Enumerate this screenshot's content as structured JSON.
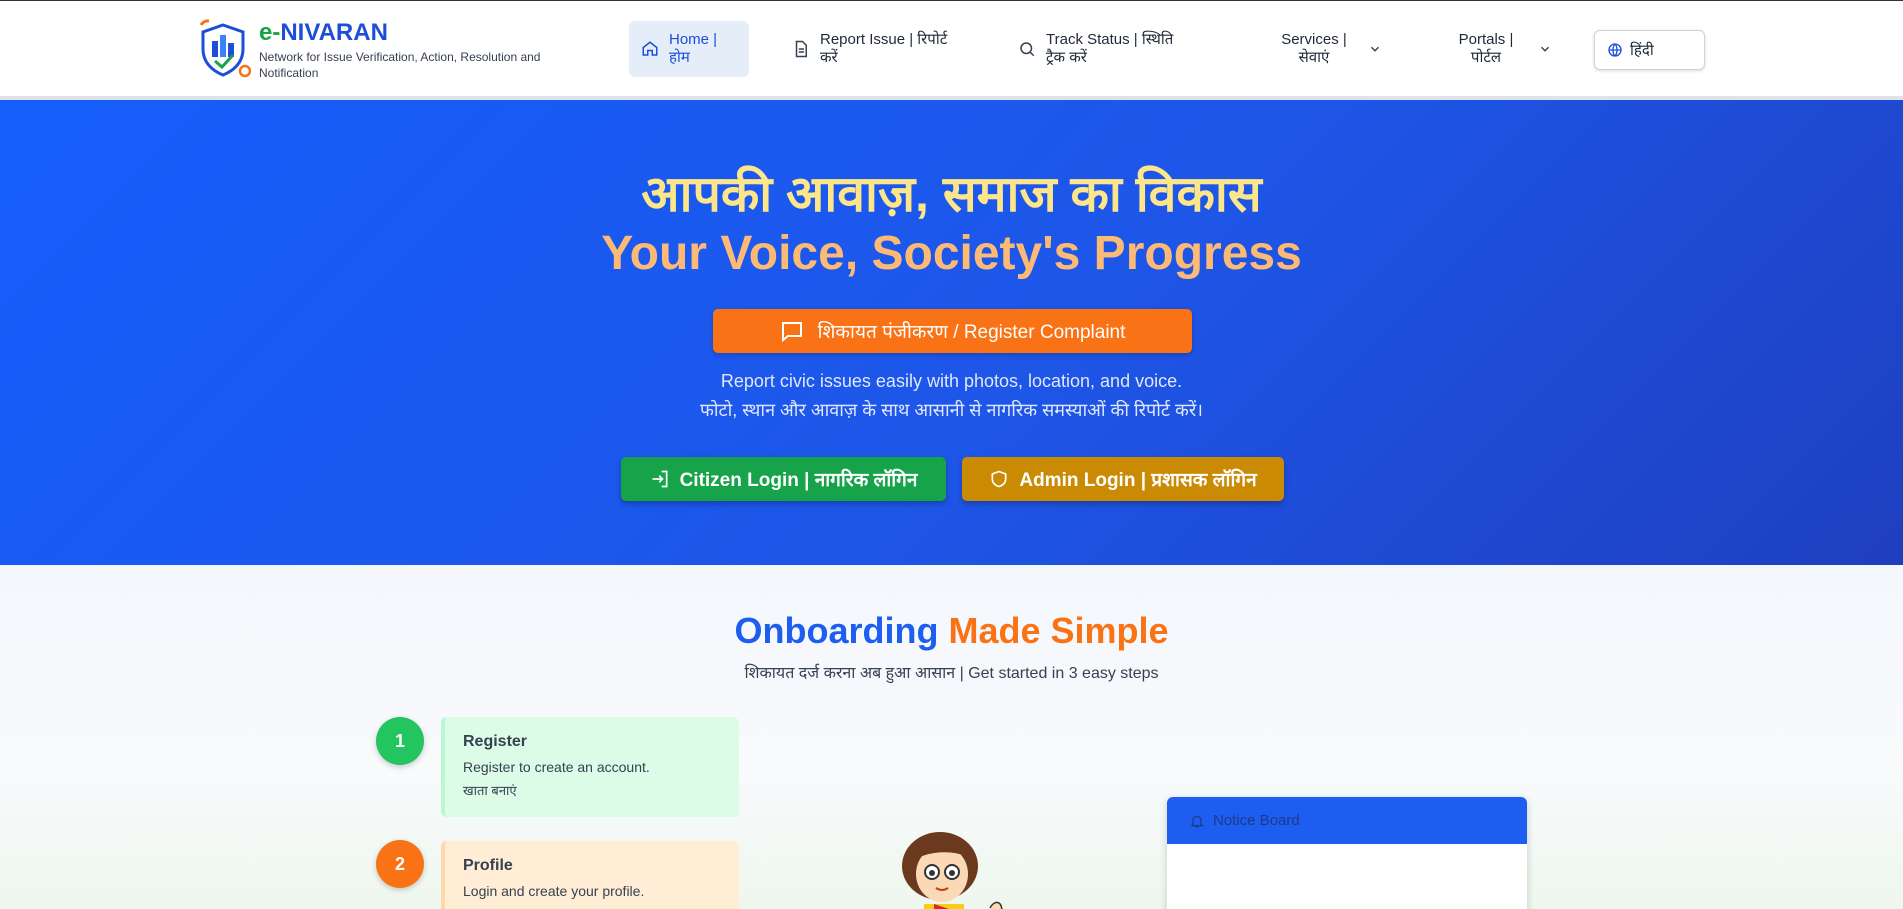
{
  "brand": {
    "name_prefix": "e-",
    "name_main": "NIVARAN",
    "tagline": "Network for Issue Verification, Action, Resolution and Notification"
  },
  "nav": {
    "home": "Home | होम",
    "report": "Report Issue | रिपोर्ट करें",
    "track": "Track Status | स्थिति ट्रैक करें",
    "services": "Services | सेवाएं",
    "portals": "Portals | पोर्टल",
    "language": "हिंदी"
  },
  "hero": {
    "title_hi": "आपकी आवाज़, समाज का विकास",
    "title_en": "Your Voice, Society's Progress",
    "register_label": "शिकायत पंजीकरण / Register Complaint",
    "sub_en": "Report civic issues easily with photos, location, and voice.",
    "sub_hi": "फोटो, स्थान और आवाज़ के साथ आसानी से नागरिक समस्याओं की रिपोर्ट करें।",
    "citizen_login": "Citizen Login | नागरिक लॉगिन",
    "admin_login": "Admin Login | प्रशासक लॉगिन"
  },
  "onboarding": {
    "title_a": "Onboarding",
    "title_b": "Made Simple",
    "subtitle": "शिकायत दर्ज करना अब हुआ आसान | Get started in 3 easy steps",
    "steps": [
      {
        "num": "1",
        "title": "Register",
        "desc": "Register to create an account.",
        "desc_hi": "खाता बनाएं"
      },
      {
        "num": "2",
        "title": "Profile",
        "desc": "Login and create your profile."
      }
    ]
  },
  "notice_board": {
    "title": "Notice Board"
  },
  "colors": {
    "primary_blue": "#155efc",
    "brand_green": "#16a34a",
    "accent_orange": "#f97316",
    "admin_gold": "#ca8a04",
    "hero_title_yellow": "#fde68a",
    "hero_title_peach": "#fdba74"
  },
  "icons": {
    "logo": "shield-city-logo",
    "home": "home-icon",
    "report": "document-icon",
    "track": "search-icon",
    "chevron": "chevron-down-icon",
    "language": "globe-icon",
    "register": "message-square-icon",
    "citizen": "login-arrow-icon",
    "admin": "shield-icon",
    "notice": "bell-icon"
  }
}
